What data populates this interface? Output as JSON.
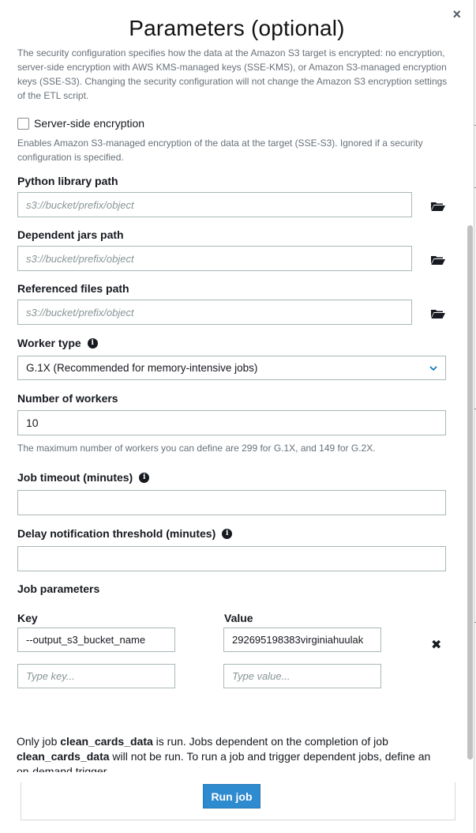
{
  "modal": {
    "title": "Parameters (optional)",
    "close_glyph": "×"
  },
  "security_help": "The security configuration specifies how the data at the Amazon S3 target is encrypted: no encryption, server-side encryption with AWS KMS-managed keys (SSE-KMS), or Amazon S3-managed encryption keys (SSE-S3). Changing the security configuration will not change the Amazon S3 encryption settings of the ETL script.",
  "sse": {
    "label": "Server-side encryption",
    "checked": false,
    "help": "Enables Amazon S3-managed encryption of the data at the target (SSE-S3). Ignored if a security configuration is specified."
  },
  "python_library": {
    "label": "Python library path",
    "placeholder": "s3://bucket/prefix/object",
    "value": ""
  },
  "dependent_jars": {
    "label": "Dependent jars path",
    "placeholder": "s3://bucket/prefix/object",
    "value": ""
  },
  "referenced_files": {
    "label": "Referenced files path",
    "placeholder": "s3://bucket/prefix/object",
    "value": ""
  },
  "worker_type": {
    "label": "Worker type",
    "selected": "G.1X (Recommended for memory-intensive jobs)"
  },
  "num_workers": {
    "label": "Number of workers",
    "value": "10",
    "help": "The maximum number of workers you can define are 299 for G.1X, and 149 for G.2X."
  },
  "job_timeout": {
    "label": "Job timeout (minutes)",
    "value": ""
  },
  "delay_threshold": {
    "label": "Delay notification threshold (minutes)",
    "value": ""
  },
  "job_parameters": {
    "label": "Job parameters",
    "key_header": "Key",
    "value_header": "Value",
    "rows": [
      {
        "key": "--output_s3_bucket_name",
        "value": "292695198383virginiahuulak"
      }
    ],
    "new_key_placeholder": "Type key...",
    "new_value_placeholder": "Type value...",
    "remove_glyph": "✖"
  },
  "footer": {
    "note_1": "Only job ",
    "job_name_1": "clean_cards_data",
    "note_2": " is run. Jobs dependent on the completion of job ",
    "job_name_2": "clean_cards_data",
    "note_3": " will not be run. To run a job and trigger dependent jobs, define an on-demand trigger.",
    "run_button": "Run job"
  },
  "icons": {
    "folder": "folder-open-icon",
    "info": "info-icon",
    "chevron": "chevron-down-icon",
    "close": "close-icon"
  },
  "colors": {
    "primary_button": "#2e8bd0",
    "label_text": "#16191f",
    "help_text": "#687078",
    "input_border": "#aab7b8"
  }
}
